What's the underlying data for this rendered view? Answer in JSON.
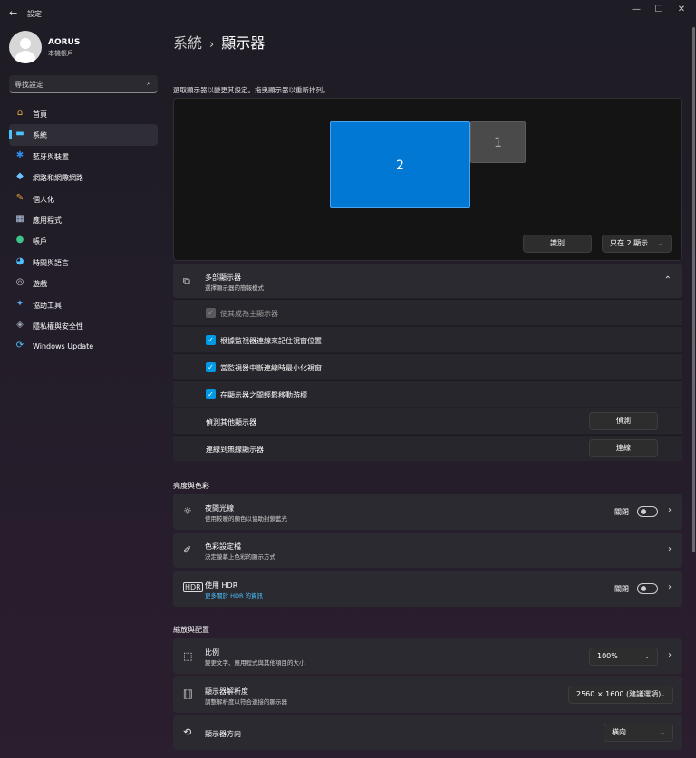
{
  "window": {
    "title": "設定",
    "back": "←",
    "min": "—",
    "max": "☐",
    "close": "✕"
  },
  "profile": {
    "name": "AORUS",
    "account": "本機帳戶"
  },
  "search": {
    "placeholder": "尋找設定",
    "icon": "search-icon"
  },
  "nav": [
    {
      "label": "首頁",
      "icon": "home-icon",
      "glyph": "⌂",
      "color": "#e8b04a"
    },
    {
      "label": "系統",
      "icon": "system-icon",
      "glyph": "▬",
      "color": "#4cc2ff"
    },
    {
      "label": "藍牙與裝置",
      "icon": "bluetooth-icon",
      "glyph": "✱",
      "color": "#2f8df0"
    },
    {
      "label": "網路和網際網路",
      "icon": "wifi-icon",
      "glyph": "◆",
      "color": "#6fc4ff"
    },
    {
      "label": "個人化",
      "icon": "brush-icon",
      "glyph": "✎",
      "color": "#f0a040"
    },
    {
      "label": "應用程式",
      "icon": "apps-icon",
      "glyph": "▦",
      "color": "#b0c4de"
    },
    {
      "label": "帳戶",
      "icon": "account-icon",
      "glyph": "●",
      "color": "#3dc48a"
    },
    {
      "label": "時間與語言",
      "icon": "globe-clock-icon",
      "glyph": "◕",
      "color": "#4cc2ff"
    },
    {
      "label": "遊戲",
      "icon": "gamepad-icon",
      "glyph": "◎",
      "color": "#cfcfcf"
    },
    {
      "label": "協助工具",
      "icon": "accessibility-icon",
      "glyph": "✦",
      "color": "#5aaaf0"
    },
    {
      "label": "隱私權與安全性",
      "icon": "shield-icon",
      "glyph": "◈",
      "color": "#9aa4b0"
    },
    {
      "label": "Windows Update",
      "icon": "update-icon",
      "glyph": "⟳",
      "color": "#4cc2ff"
    }
  ],
  "breadcrumb": {
    "parent": "系統",
    "sep": "›",
    "current": "顯示器"
  },
  "arrangement": {
    "hint": "選取顯示器以變更其設定。拖曳顯示器以重新排列。",
    "monitor_primary": "2",
    "monitor_secondary": "1",
    "identify_label": "識別",
    "mode_value": "只在 2 顯示"
  },
  "multi": {
    "title": "多部顯示器",
    "subtitle": "選擇顯示器的簡報模式",
    "make_main": "使其成為主顯示器",
    "remember": "根據監視器連線來記住視窗位置",
    "minimize": "當監視器中斷連線時最小化視窗",
    "ease_cursor": "在顯示器之間輕鬆移動游標",
    "detect_label": "偵測其他顯示器",
    "detect_btn": "偵測",
    "wireless_label": "連線到無線顯示器",
    "wireless_btn": "連線"
  },
  "brightness": {
    "heading": "亮度與色彩",
    "night_title": "夜間光線",
    "night_sub": "使用較暖的顏色以協助封鎖藍光",
    "night_state": "關閉",
    "color_title": "色彩設定檔",
    "color_sub": "決定螢幕上色彩的顯示方式",
    "hdr_title": "使用 HDR",
    "hdr_link": "更多關於 HDR 的資訊",
    "hdr_state": "關閉"
  },
  "scale": {
    "heading": "縮放與配置",
    "scale_title": "比例",
    "scale_sub": "變更文字、應用程式與其他項目的大小",
    "scale_value": "100%",
    "res_title": "顯示器解析度",
    "res_sub": "調整解析度以符合連接的顯示器",
    "res_value": "2560 × 1600 (建議選項)",
    "orient_title": "顯示器方向",
    "orient_value": "橫向"
  }
}
